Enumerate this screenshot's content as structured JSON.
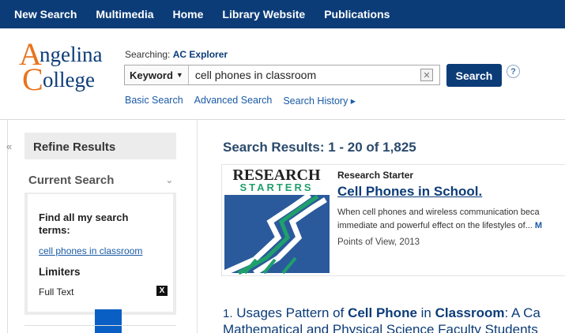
{
  "nav": {
    "items": [
      "New Search",
      "Multimedia",
      "Home",
      "Library Website",
      "Publications"
    ]
  },
  "logo": {
    "line1": "Angelina",
    "line2": "College"
  },
  "search": {
    "searching_prefix": "Searching:",
    "database": "AC Explorer",
    "field_label": "Keyword",
    "query": "cell phones in classroom",
    "button_label": "Search",
    "help_label": "?",
    "links": [
      "Basic Search",
      "Advanced Search",
      "Search History ▸"
    ]
  },
  "sidebar": {
    "collapse_glyph": "«",
    "refine_title": "Refine Results",
    "current_title": "Current Search",
    "find_all": "Find all my search terms:",
    "term": "cell phones in classroom",
    "limiters": "Limiters",
    "full_text": "Full Text",
    "remove_glyph": "X"
  },
  "results": {
    "title": "Search Results: 1 - 20 of 1,825",
    "starter": {
      "logo_line1": "RESEARCH",
      "logo_line2": "STARTERS",
      "label": "Research Starter",
      "title": "Cell Phones in School.",
      "desc_line1": "When cell phones and wireless communication beca",
      "desc_line2": "immediate and powerful effect on the lifestyles of...",
      "more": "M",
      "source": "Points of View, 2013"
    },
    "item1": {
      "number": "1.",
      "line1_pre": "Usages Pattern of ",
      "line1_b1": "Cell Phone",
      "line1_mid": " in ",
      "line1_b2": "Classroom",
      "line1_post": ": A Ca",
      "line2": "Mathematical and Physical Science Faculty Students"
    }
  },
  "colors": {
    "nav_bg": "#0c3c78",
    "brand_blue": "#0c3c78",
    "logo_orange": "#e8731c",
    "link_blue": "#1a5aa6"
  }
}
